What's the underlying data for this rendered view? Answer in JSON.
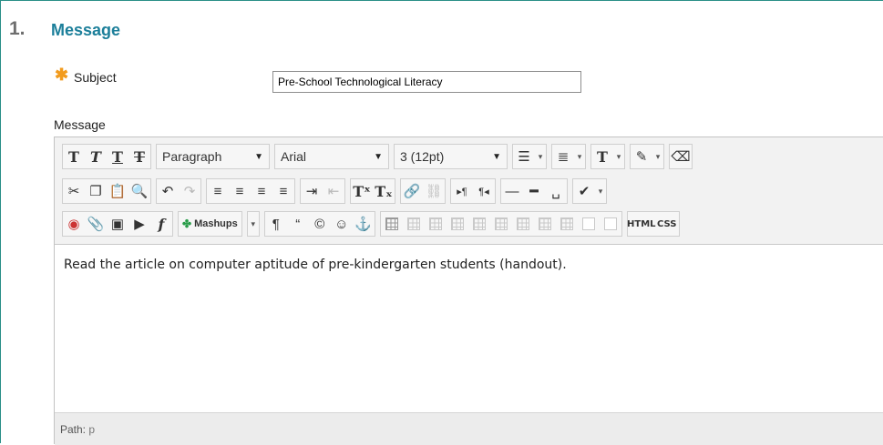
{
  "section": {
    "number": "1.",
    "title": "Message"
  },
  "subject": {
    "label": "Subject",
    "required_marker": "✱",
    "value": "Pre-School Technological Literacy"
  },
  "message": {
    "label": "Message"
  },
  "toolbar": {
    "paragraph_select": "Paragraph",
    "font_select": "Arial",
    "size_select": "3 (12pt)",
    "mashups_label": "Mashups",
    "html_label": "HTML",
    "css_label": "CSS"
  },
  "editor": {
    "content": "Read the article on computer aptitude of pre-kindergarten students (handout).",
    "path_label": "Path:",
    "path_value": "p"
  },
  "colors": {
    "accent": "#1c7f9a",
    "required": "#f29b1d",
    "frame": "#2a8f87"
  }
}
